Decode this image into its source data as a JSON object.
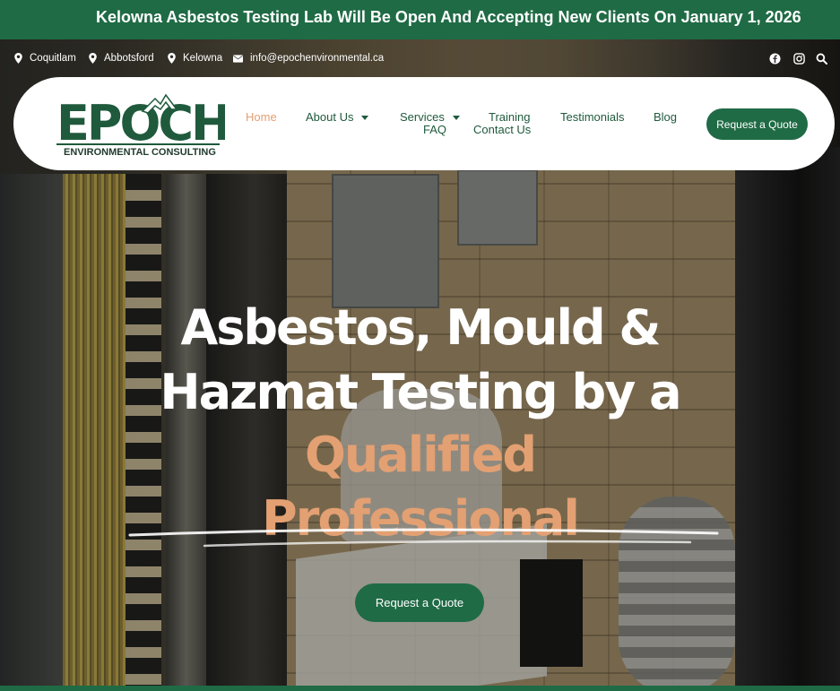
{
  "announcement": {
    "text": "Kelowna Asbestos Testing Lab Will Be Open And Accepting New Clients On January 1, 2026"
  },
  "topbar": {
    "locations": [
      "Coquitlam",
      "Abbotsford",
      "Kelowna"
    ],
    "email": "info@epochenvironmental.ca",
    "social_icons": [
      "facebook-icon",
      "instagram-icon",
      "search-icon"
    ]
  },
  "logo": {
    "wordmark": "EPOCH",
    "tagline": "ENVIRONMENTAL CONSULTING"
  },
  "nav": {
    "home": "Home",
    "about": "About Us",
    "services": "Services",
    "training": "Training",
    "testimonials": "Testimonials",
    "blog": "Blog",
    "faq": "FAQ",
    "contact": "Contact Us",
    "quote_button": "Request a Quote"
  },
  "hero": {
    "line1": "Asbestos, Mould &",
    "line2": "Hazmat Testing by a",
    "line3": "Qualified",
    "line4": "Professional",
    "cta": "Request a Quote"
  },
  "colors": {
    "brand_green": "#1f6b45",
    "accent_orange": "#e3a072",
    "link_green": "#1f5a3c"
  }
}
